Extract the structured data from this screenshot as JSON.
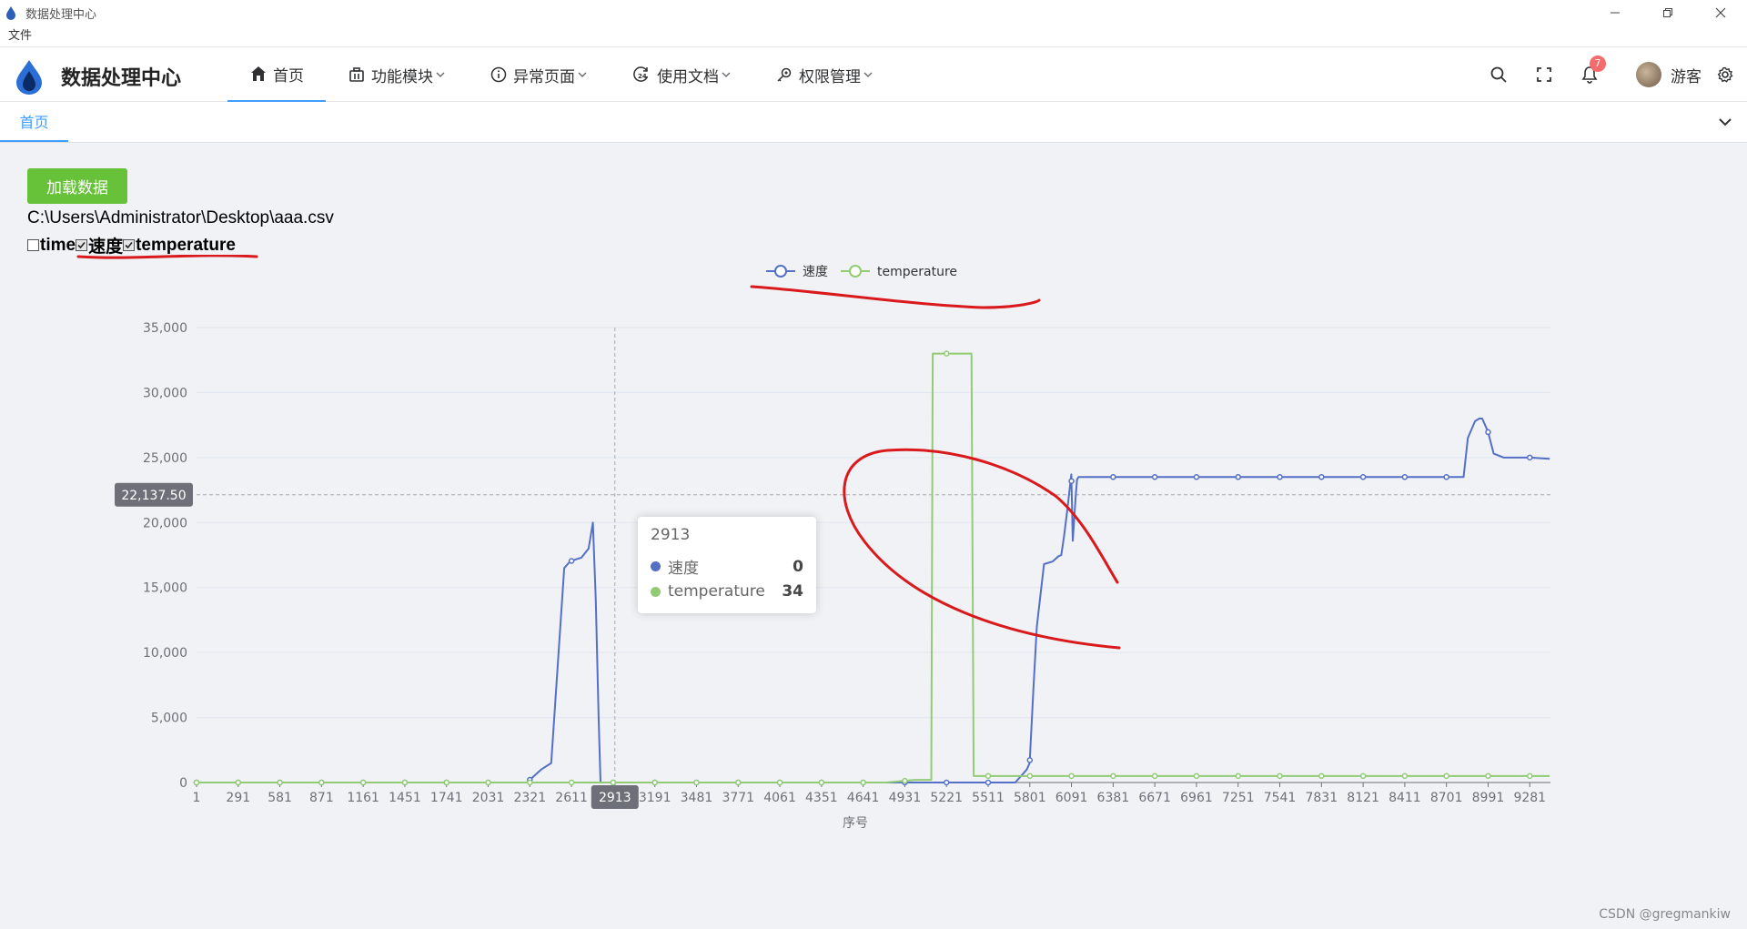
{
  "window": {
    "title": "数据处理中心"
  },
  "menubar": {
    "file": "文件"
  },
  "header": {
    "brand": "数据处理中心",
    "nav": [
      {
        "label": "首页",
        "icon": "home-icon"
      },
      {
        "label": "功能模块",
        "icon": "briefcase-icon"
      },
      {
        "label": "异常页面",
        "icon": "info-icon"
      },
      {
        "label": "使用文档",
        "icon": "clock-24-icon"
      },
      {
        "label": "权限管理",
        "icon": "key-icon"
      }
    ],
    "notifications": "7",
    "username": "游客"
  },
  "tabs": {
    "home": "首页"
  },
  "main": {
    "load_button": "加载数据",
    "file_path": "C:\\Users\\Administrator\\Desktop\\aaa.csv",
    "columns": [
      {
        "label": "time",
        "checked": false
      },
      {
        "label": "速度",
        "checked": true
      },
      {
        "label": "temperature",
        "checked": true
      }
    ]
  },
  "tooltip": {
    "title": "2913",
    "rows": [
      {
        "name": "速度",
        "value": "0",
        "color": "#5470c6"
      },
      {
        "name": "temperature",
        "value": "34",
        "color": "#91cc75"
      }
    ]
  },
  "watermark": "CSDN @gregmankiw",
  "chart_data": {
    "type": "line",
    "xlabel": "序号",
    "ylabel": "",
    "ylim": [
      0,
      35000
    ],
    "yticks": [
      "0",
      "5,000",
      "10,000",
      "15,000",
      "20,000",
      "25,000",
      "30,000",
      "35,000"
    ],
    "xticks": [
      "1",
      "291",
      "581",
      "871",
      "1161",
      "1451",
      "1741",
      "2031",
      "2321",
      "2611",
      "2913",
      "3191",
      "3481",
      "3771",
      "4061",
      "4351",
      "4641",
      "4931",
      "5221",
      "5511",
      "5801",
      "6091",
      "6381",
      "6671",
      "6961",
      "7251",
      "7541",
      "7831",
      "8121",
      "8411",
      "8701",
      "8991",
      "9281"
    ],
    "xlim": [
      1,
      9425
    ],
    "crosshair": {
      "x": 2913,
      "x_label": "2913",
      "y": 22137.5,
      "y_label": "22,137.50"
    },
    "legend_position": "top",
    "grid": true,
    "series": [
      {
        "name": "速度",
        "color": "#5470c6",
        "x": [
          1,
          2300,
          2400,
          2470,
          2560,
          2600,
          2650,
          2680,
          2730,
          2760,
          2780,
          2800,
          2813,
          2900,
          5700,
          5780,
          5800,
          5825,
          5850,
          5900,
          5960,
          6000,
          6020,
          6040,
          6060,
          6090,
          6100,
          6120,
          6130,
          6140,
          6160,
          6200,
          8700,
          8820,
          8850,
          8900,
          8930,
          8950,
          8990,
          9030,
          9100,
          9281,
          9420
        ],
        "y": [
          0,
          0,
          1000,
          1500,
          16500,
          17000,
          17200,
          17300,
          18000,
          20000,
          14000,
          5000,
          0,
          0,
          0,
          1000,
          1500,
          7000,
          12000,
          16800,
          17000,
          17400,
          17500,
          19000,
          20800,
          23700,
          18600,
          22000,
          23300,
          23500,
          23500,
          23500,
          23500,
          23500,
          26500,
          27800,
          28000,
          28000,
          27000,
          25300,
          25000,
          25000,
          24900
        ]
      },
      {
        "name": "temperature",
        "color": "#91cc75",
        "x": [
          1,
          4800,
          5000,
          5115,
          5125,
          5385,
          5395,
          5410,
          9420
        ],
        "y": [
          0,
          0,
          200,
          200,
          33000,
          33000,
          33000,
          500,
          500
        ]
      }
    ],
    "marker_every": 290
  }
}
